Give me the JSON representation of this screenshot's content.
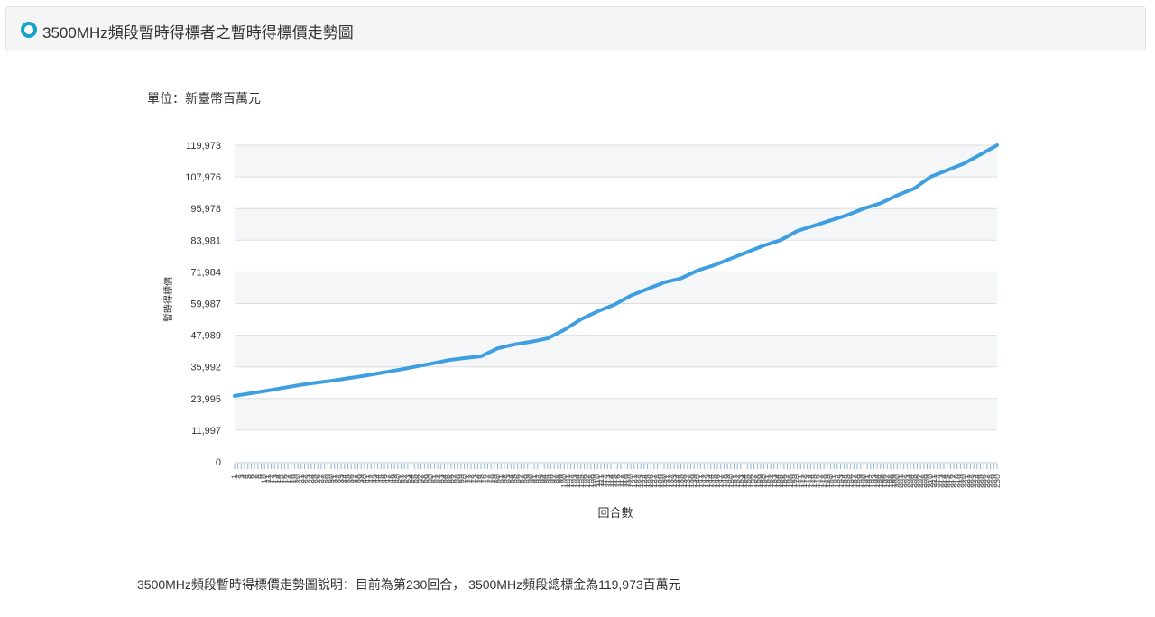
{
  "header": {
    "title": "3500MHz頻段暫時得標者之暫時得標價走勢圖"
  },
  "chart_data": {
    "type": "line",
    "unit_label": "單位：新臺幣百萬元",
    "title": "",
    "xlabel": "回合數",
    "ylabel": "暫時得標價",
    "ylim": [
      0,
      119973
    ],
    "yticks": [
      0,
      11997,
      23995,
      35992,
      47989,
      59987,
      71984,
      83981,
      95978,
      107976,
      119973
    ],
    "yticks_labels": [
      "0",
      "11,997",
      "23,995",
      "35,992",
      "47,989",
      "59,987",
      "71,984",
      "83,981",
      "95,978",
      "107,976",
      "119,973"
    ],
    "xlim": [
      1,
      230
    ],
    "grid": true,
    "color": "#3d9fe0",
    "series": [
      {
        "name": "",
        "x": [
          1,
          10,
          20,
          25,
          30,
          40,
          45,
          50,
          55,
          60,
          65,
          70,
          75,
          80,
          85,
          90,
          95,
          100,
          105,
          110,
          115,
          120,
          125,
          130,
          135,
          140,
          145,
          150,
          155,
          160,
          165,
          170,
          175,
          180,
          185,
          190,
          195,
          200,
          205,
          210,
          215,
          220,
          225,
          230
        ],
        "y": [
          25000,
          26800,
          29000,
          29900,
          30700,
          32600,
          33700,
          34800,
          36000,
          37200,
          38500,
          39300,
          40000,
          43000,
          44500,
          45500,
          46800,
          50000,
          54000,
          57000,
          59500,
          63000,
          65500,
          68000,
          69500,
          72500,
          74500,
          77000,
          79500,
          82000,
          84000,
          87500,
          89500,
          91500,
          93500,
          96000,
          98000,
          101000,
          103500,
          108000,
          110500,
          113000,
          116500,
          119973
        ]
      }
    ]
  },
  "footer": {
    "text": "3500MHz頻段暫時得標價走勢圖說明：目前為第230回合， 3500MHz頻段總標金為119,973百萬元"
  }
}
